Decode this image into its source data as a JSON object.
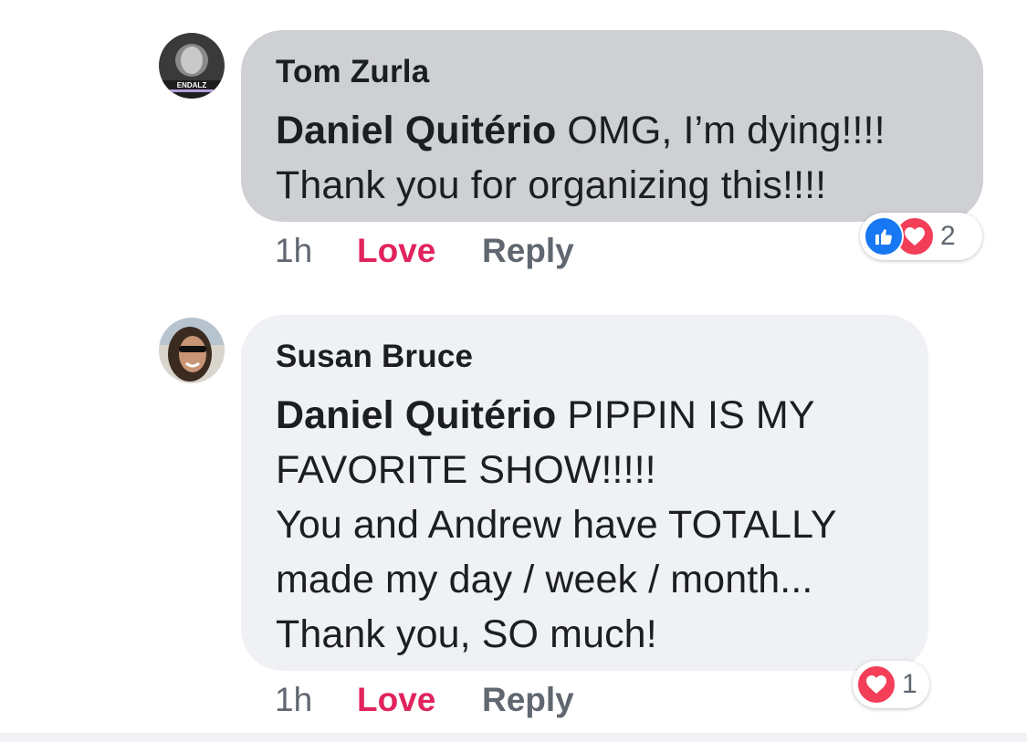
{
  "comments": [
    {
      "author": "Tom Zurla",
      "avatar_text": "ENDALZ",
      "mention": "Daniel Quitério",
      "text": " OMG, I’m dying!!!!\nThank you for organizing this!!!!",
      "time": "1h",
      "love_label": "Love",
      "reply_label": "Reply",
      "reaction_icons": [
        "like-icon",
        "heart-icon"
      ],
      "reaction_count": "2"
    },
    {
      "author": "Susan Bruce",
      "mention": "Daniel Quitério",
      "text": " PIPPIN IS MY\nFAVORITE SHOW!!!!!\nYou and Andrew have TOTALLY\nmade my day / week / month...\nThank you, SO much!",
      "time": "1h",
      "love_label": "Love",
      "reply_label": "Reply",
      "reaction_icons": [
        "heart-icon"
      ],
      "reaction_count": "1"
    }
  ],
  "colors": {
    "bubble_selected": "#ced0d4",
    "bubble_default": "#eff1f4",
    "love_active": "#e0245e",
    "like_blue": "#1877f2",
    "heart_red": "#f33e58",
    "meta_gray": "#606770"
  }
}
